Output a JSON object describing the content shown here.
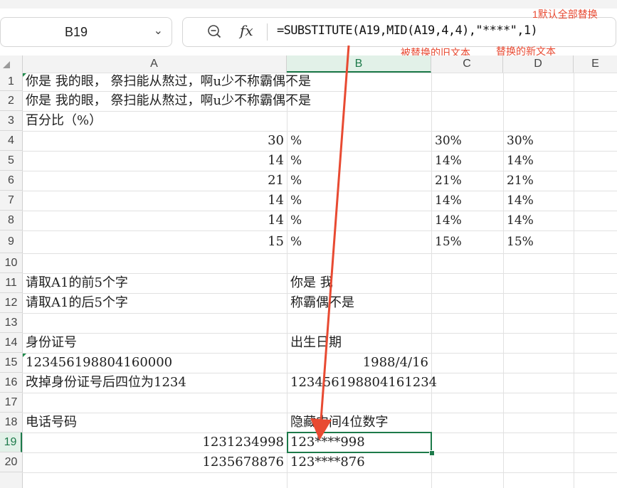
{
  "name_box": {
    "value": "B19"
  },
  "formula_bar": {
    "formula": "=SUBSTITUTE(A19,MID(A19,4,4),\"****\",1)"
  },
  "annotations": {
    "default_replace_all": "1默认全部替换",
    "old_text": "被替换的旧文本",
    "new_text": "替换的新文本"
  },
  "column_headers": [
    "A",
    "B",
    "C",
    "D",
    "E"
  ],
  "selected_column": "B",
  "row_headers": [
    "1",
    "2",
    "3",
    "4",
    "5",
    "6",
    "7",
    "8",
    "9",
    "10",
    "11",
    "12",
    "13",
    "14",
    "15",
    "16",
    "17",
    "18",
    "19",
    "20"
  ],
  "selected_row": "19",
  "cells": {
    "A1": " 你是  我的眼，  祭扫能从熬过，啊u少不称霸偶不是",
    "A2": "你是  我的眼，  祭扫能从熬过，啊u少不称霸偶不是",
    "A3": "百分比（%）",
    "A4": "30",
    "B4": "%",
    "C4": "30%",
    "D4": "30%",
    "A5": "14",
    "B5": "%",
    "C5": "14%",
    "D5": "14%",
    "A6": "21",
    "B6": "%",
    "C6": "21%",
    "D6": "21%",
    "A7": "14",
    "B7": "%",
    "C7": "14%",
    "D7": "14%",
    "A8": "14",
    "B8": "%",
    "C8": "14%",
    "D8": "14%",
    "A9": "15",
    "B9": "%",
    "C9": "15%",
    "D9": "15%",
    "A11": "请取A1的前5个字",
    "B11": " 你是  我",
    "A12": "请取A1的后5个字",
    "B12": "称霸偶不是",
    "A14": "身份证号",
    "B14": "出生日期",
    "A15": "123456198804160000",
    "B15": "1988/4/16",
    "A16": "改掉身份证号后四位为1234",
    "B16": "123456198804161234",
    "A18": "电话号码",
    "B18": "隐藏中间4位数字",
    "A19": "1231234998",
    "B19": "123****998",
    "A20": "1235678876",
    "B20": "123****876"
  },
  "colors": {
    "accent_green": "#1d7a4a",
    "annotation_red": "#e84a32"
  }
}
